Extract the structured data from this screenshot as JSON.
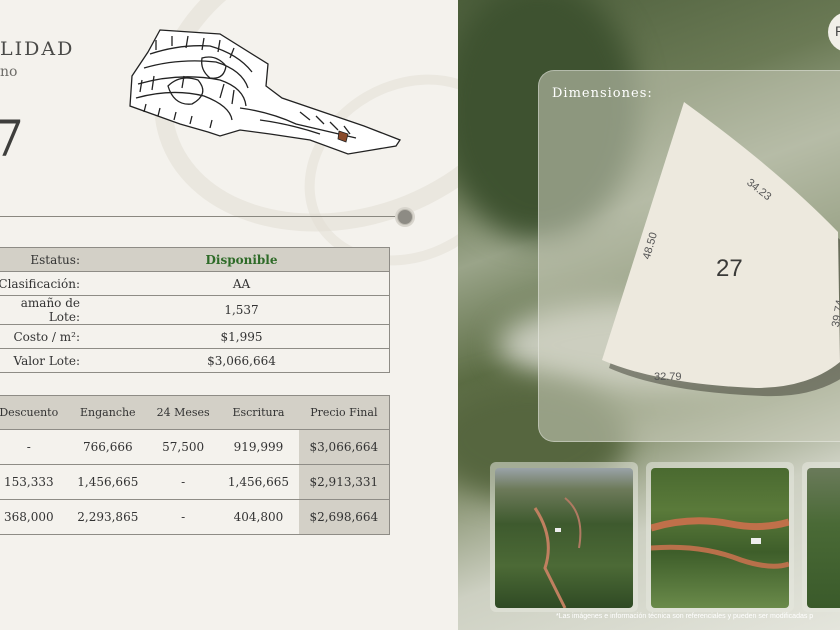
{
  "header": {
    "title": "LIDAD",
    "subtitle": "no",
    "lot_number_large": "7"
  },
  "info_table": {
    "rows": [
      {
        "label": "Estatus:",
        "value": "Disponible"
      },
      {
        "label": "Clasificación:",
        "value": "AA"
      },
      {
        "label": "amaño de Lote:",
        "value": "1,537"
      },
      {
        "label": "Costo / m²:",
        "value": "$1,995"
      },
      {
        "label": "Valor Lote:",
        "value": "$3,066,664"
      }
    ],
    "status_color": "#2e6b28"
  },
  "payment_table": {
    "headers": [
      "Descuento",
      "Enganche",
      "24 Meses",
      "Escritura",
      "Precio Final"
    ],
    "rows": [
      [
        "-",
        "766,666",
        "57,500",
        "919,999",
        "$3,066,664"
      ],
      [
        "153,333",
        "1,456,665",
        "-",
        "1,456,665",
        "$2,913,331"
      ],
      [
        "368,000",
        "2,293,865",
        "-",
        "404,800",
        "$2,698,664"
      ]
    ]
  },
  "dimensions": {
    "label": "Dimensiones:",
    "lot_number": "27",
    "sides": [
      "34.23",
      "48.50",
      "39.74",
      "32.79"
    ]
  },
  "top_right_button": "P",
  "footer_note": "*Las imágenes e información técnica son referenciales y pueden ser modificadas p",
  "icons": {
    "site_map": "site-map-icon",
    "slider": "slider-knob"
  }
}
